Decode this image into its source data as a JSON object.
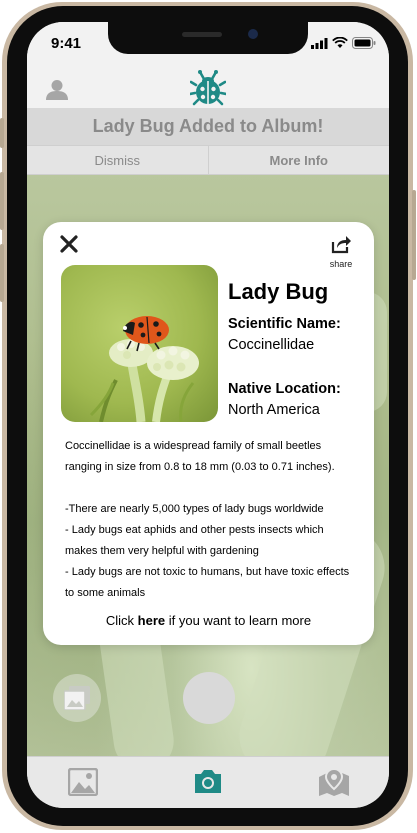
{
  "status_bar": {
    "time": "9:41"
  },
  "header": {
    "profile_icon": "person-icon",
    "logo_icon": "ladybug-logo-icon"
  },
  "toast": {
    "message": "Lady Bug Added to Album!",
    "dismiss_label": "Dismiss",
    "more_info_label": "More Info"
  },
  "card": {
    "close_icon": "close-icon",
    "share_icon": "share-icon",
    "share_label": "share",
    "title": "Lady Bug",
    "scientific_name_label": "Scientific Name:",
    "scientific_name": "Coccinellidae",
    "native_location_label": "Native Location:",
    "native_location": "North America",
    "description": "Coccinellidae is a widespread family of small beetles ranging in size from 0.8 to 18 mm (0.03 to 0.71 inches).",
    "facts": [
      "-There are nearly 5,000 types of lady bugs worldwide",
      "- Lady bugs eat aphids and other pests insects which makes them very helpful with gardening",
      "- Lady bugs are not toxic to humans, but have toxic effects to some animals"
    ],
    "learn_more": {
      "prefix": "Click ",
      "link": "here",
      "suffix": " if you want to learn more"
    }
  },
  "tab_bar": {
    "items": [
      {
        "icon": "image-icon",
        "active": false
      },
      {
        "icon": "camera-icon",
        "active": true
      },
      {
        "icon": "map-pin-icon",
        "active": false
      }
    ],
    "active_color": "#1f8a86",
    "inactive_color": "#a6a6a6"
  },
  "colors": {
    "accent": "#1f8a86",
    "toast_text": "#8a8a8a"
  }
}
